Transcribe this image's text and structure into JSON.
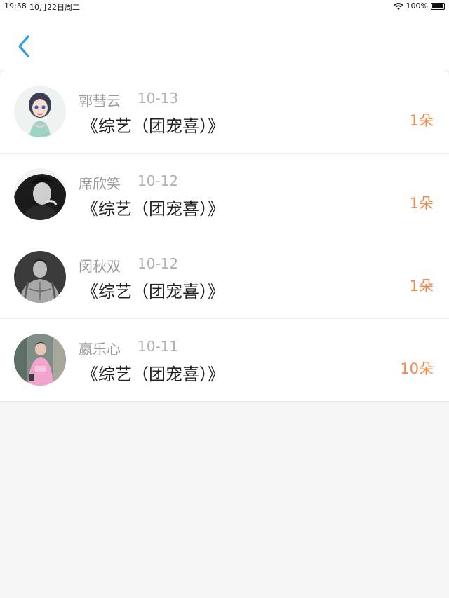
{
  "status_bar": {
    "time": "19:58",
    "date": "10月22日周二",
    "battery": "100%"
  },
  "nav": {
    "back_icon": "chevron-left-icon",
    "accent": "#2f9ce8"
  },
  "list": [
    {
      "name": "郭彗云",
      "date": "10-13",
      "title": "《综艺（团宠喜）》",
      "count": "1朵"
    },
    {
      "name": "席欣笑",
      "date": "10-12",
      "title": "《综艺（团宠喜）》",
      "count": "1朵"
    },
    {
      "name": "闵秋双",
      "date": "10-12",
      "title": "《综艺（团宠喜）》",
      "count": "1朵"
    },
    {
      "name": "嬴乐心",
      "date": "10-11",
      "title": "《综艺（团宠喜）》",
      "count": "10朵"
    }
  ],
  "colors": {
    "count_text": "#f08a4b",
    "name_text": "#9a9a9a"
  }
}
